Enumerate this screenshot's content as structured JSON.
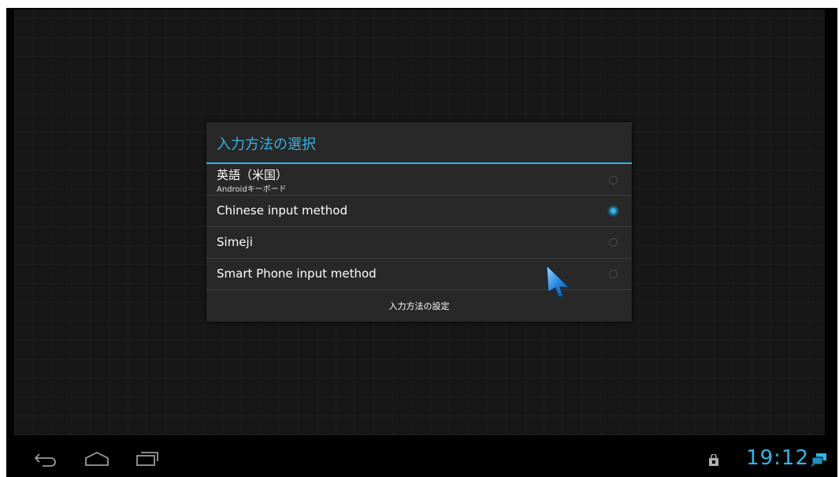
{
  "dialog": {
    "title": "入力方法の選択",
    "items": [
      {
        "label": "英語（米国）",
        "sublabel": "Androidキーボード",
        "selected": false
      },
      {
        "label": "Chinese input method",
        "selected": true
      },
      {
        "label": "Simeji",
        "selected": false
      },
      {
        "label": "Smart Phone input method",
        "selected": false
      }
    ],
    "settings_label": "入力方法の設定"
  },
  "status_bar": {
    "time": "19:12"
  },
  "colors": {
    "accent": "#33b5e5",
    "dialog_bg": "#282828",
    "divider": "#3d3d3d"
  },
  "icons": {
    "back": "back-icon",
    "home": "home-icon",
    "recents": "recents-icon",
    "shopping_bag": "shopping-bag-icon",
    "notification": "notification-icon",
    "cursor": "mouse-pointer-icon"
  }
}
